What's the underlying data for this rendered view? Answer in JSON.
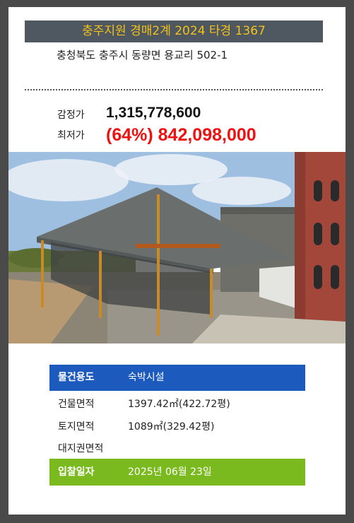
{
  "header": {
    "title": "충주지원 경매2계 2024 타경 1367"
  },
  "address": "충청북도 충주시 동량면 용교리 502-1",
  "prices": {
    "appraisal_label": "감정가",
    "appraisal_value": "1,315,778,600",
    "minimum_label": "최저가",
    "minimum_value": "(64%) 842,098,000"
  },
  "details": {
    "use_label": "물건용도",
    "use_value": "숙박시설",
    "building_area_label": "건물면적",
    "building_area_value": "1397.42㎡(422.72평)",
    "land_area_label": "토지면적",
    "land_area_value": "1089㎡(329.42평)",
    "land_right_label": "대지권면적",
    "land_right_value": "",
    "bid_date_label": "입찰일자",
    "bid_date_value": "2025년 06월 23일"
  },
  "colors": {
    "title_bg": "#4f5760",
    "title_text": "#f2c21b",
    "minimum_price": "#ee1111",
    "use_row_bg": "#1c5bbd",
    "bid_row_bg": "#7aba1e"
  }
}
